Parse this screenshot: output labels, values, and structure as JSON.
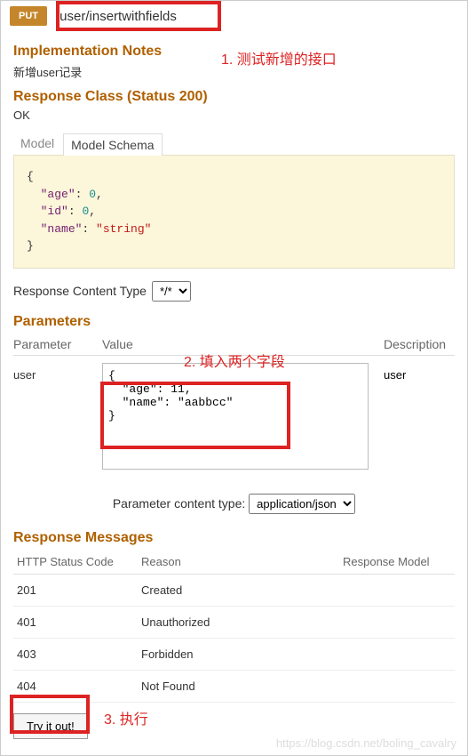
{
  "method": "PUT",
  "path": "/user/insertwithfields",
  "notes_heading": "Implementation Notes",
  "notes_text": "新增user记录",
  "resp_class_heading": "Response Class (Status 200)",
  "resp_class_text": "OK",
  "tabs": {
    "model": "Model",
    "schema": "Model Schema"
  },
  "schema_fields": [
    {
      "key": "age",
      "value": "0",
      "type": "number"
    },
    {
      "key": "id",
      "value": "0",
      "type": "number"
    },
    {
      "key": "name",
      "value": "\"string\"",
      "type": "string"
    }
  ],
  "rct_label": "Response Content Type",
  "rct_select": "*/*",
  "params_heading": "Parameters",
  "param_headers": {
    "p": "Parameter",
    "v": "Value",
    "d": "Description"
  },
  "param": {
    "name": "user",
    "desc": "user",
    "value": "{\n  \"age\": 11,\n  \"name\": \"aabbcc\"\n}"
  },
  "pct_label": "Parameter content type:",
  "pct_select": "application/json",
  "rm_heading": "Response Messages",
  "rm_headers": {
    "code": "HTTP Status Code",
    "reason": "Reason",
    "model": "Response Model"
  },
  "rm_rows": [
    {
      "code": "201",
      "reason": "Created"
    },
    {
      "code": "401",
      "reason": "Unauthorized"
    },
    {
      "code": "403",
      "reason": "Forbidden"
    },
    {
      "code": "404",
      "reason": "Not Found"
    }
  ],
  "tryit": "Try it out!",
  "annotations": {
    "a1": "1. 测试新增的接口",
    "a2": "2. 填入两个字段",
    "a3": "3. 执行"
  },
  "watermark": "https://blog.csdn.net/boling_cavalry"
}
